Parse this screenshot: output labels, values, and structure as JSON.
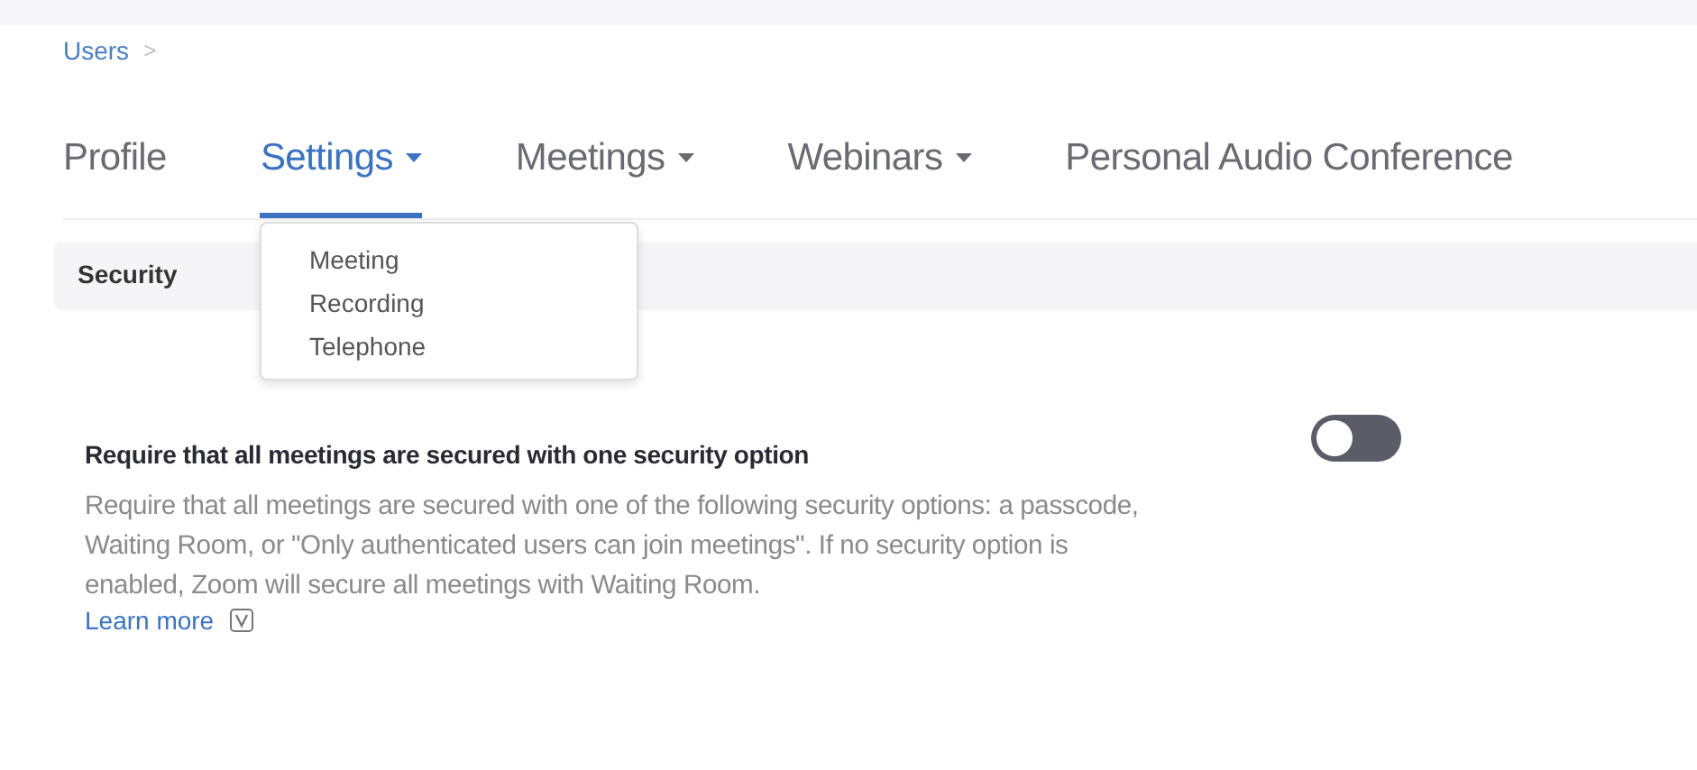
{
  "breadcrumb": {
    "label": "Users",
    "separator": ">"
  },
  "tabs": [
    {
      "label": "Profile",
      "selected": false,
      "dropdown": false
    },
    {
      "label": "Settings",
      "selected": true,
      "dropdown": true
    },
    {
      "label": "Meetings",
      "selected": false,
      "dropdown": true
    },
    {
      "label": "Webinars",
      "selected": false,
      "dropdown": true
    },
    {
      "label": "Personal Audio Conference",
      "selected": false,
      "dropdown": false
    }
  ],
  "dropdown_menu": {
    "items": [
      "Meeting",
      "Recording",
      "Telephone"
    ]
  },
  "section": {
    "title": "Security"
  },
  "setting": {
    "title": "Require that all meetings are secured with one security option",
    "description": "Require that all meetings are secured with one of the following security options: a passcode, Waiting Room, or \"Only authenticated users can join meetings\". If no security option is enabled, Zoom will secure all meetings with Waiting Room.",
    "link": "Learn more",
    "on": false
  }
}
